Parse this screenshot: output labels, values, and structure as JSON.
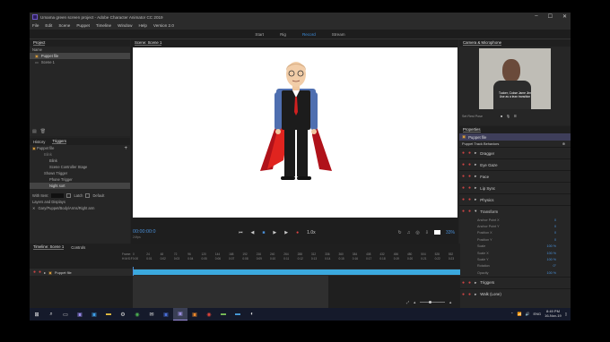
{
  "window": {
    "title": "Umama green screen project - Adobe Character Animator CC 2019",
    "controls": [
      "–",
      "☐",
      "✕"
    ]
  },
  "menu": [
    "File",
    "Edit",
    "Scene",
    "Puppet",
    "Timeline",
    "Window",
    "Help",
    "Version 2.0"
  ],
  "workspaces": [
    "Start",
    "Rig",
    "Record",
    "Stream"
  ],
  "active_workspace": "Record",
  "project": {
    "title": "Project",
    "name_header": "Name",
    "items": [
      "Puppet file",
      "Scene 1"
    ]
  },
  "triggers": {
    "tabs": [
      "History",
      "Triggers"
    ],
    "puppet": "Puppet file",
    "controls": [
      "Blink",
      "Scene Controller Stage"
    ],
    "shows_header": "Shows Trigger",
    "list": [
      "Phone Trigger",
      "Night sort"
    ],
    "with_item_label": "With Item:",
    "latch_label": "Latch",
    "default_label": "Default",
    "layers_label": "Layers and Displays",
    "layer_path": "Gary/Puppet/Body/Arms/Right arm"
  },
  "scene": {
    "tab": "Scene: Scene 1",
    "timecode": "00:00:00:0",
    "fps": "24fps",
    "zoom": "33%",
    "speed": "1.0x"
  },
  "camera": {
    "title": "Camera & Microphone",
    "caption_line1": "Tucker, Cokse Jame Jim",
    "caption_line2": "Use as a lean transition",
    "set_rest_pose": "Set Rest Pose"
  },
  "properties": {
    "title": "Properties",
    "puppet": "Puppet file",
    "track_behaviors": "Puppet Track Behaviors",
    "behaviors": [
      "Dragger",
      "Eye Gaze",
      "Face",
      "Lip Sync",
      "Physics",
      "Transform"
    ],
    "transform_rows": [
      {
        "name": "Anchor Point X",
        "value": "0"
      },
      {
        "name": "Anchor Point Y",
        "value": "0"
      },
      {
        "name": "Position X",
        "value": "0"
      },
      {
        "name": "Position Y",
        "value": "0"
      },
      {
        "name": "Scale",
        "value": "100 %"
      },
      {
        "name": "Scale X",
        "value": "100 %"
      },
      {
        "name": "Scale Y",
        "value": "100 %"
      },
      {
        "name": "Rotation",
        "value": "0°"
      },
      {
        "name": "Opacity",
        "value": "100 %"
      }
    ],
    "bottom_behaviors": [
      "Triggers",
      "Walk (Lone)"
    ]
  },
  "timeline": {
    "tabs": [
      "Timeline: Scene 1",
      "Controls"
    ],
    "frame_label": "Frame:",
    "time_label": "H:M:S:F",
    "track": "Puppet file",
    "frame_ticks": [
      "0",
      "24",
      "48",
      "72",
      "96",
      "120",
      "144",
      "168",
      "192",
      "216",
      "240",
      "264",
      "288",
      "312",
      "336",
      "360",
      "384",
      "408",
      "432",
      "456",
      "480",
      "504",
      "528",
      "552"
    ],
    "time_ticks": [
      "0:00",
      "0:01",
      "0:02",
      "0:03",
      "0:04",
      "0:05",
      "0:06",
      "0:07",
      "0:08",
      "0:09",
      "0:10",
      "0:11",
      "0:12",
      "0:13",
      "0:14",
      "0:15",
      "0:16",
      "0:17",
      "0:18",
      "0:19",
      "0:20",
      "0:21",
      "0:22",
      "0:23"
    ]
  },
  "taskbar": {
    "time": "8:49 PM",
    "date": "16-Nov-19",
    "lang": "ENG"
  }
}
